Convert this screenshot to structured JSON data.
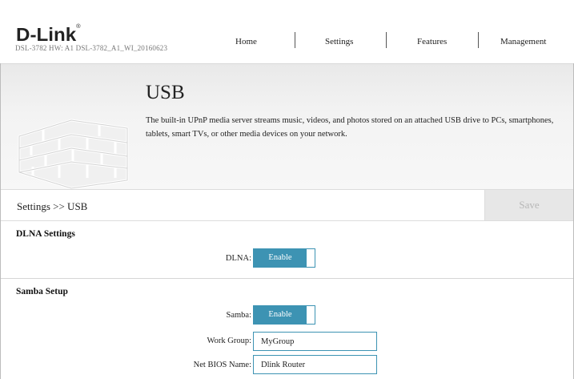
{
  "header": {
    "logo": "D-Link",
    "model_info": "DSL-3782  HW: A1  DSL-3782_A1_WI_20160623",
    "nav": [
      "Home",
      "Settings",
      "Features",
      "Management"
    ]
  },
  "banner": {
    "title": "USB",
    "description": "The built-in UPnP media server streams music, videos, and photos stored on an attached USB drive to PCs, smartphones, tablets, smart TVs, or other media devices on your network."
  },
  "breadcrumb": "Settings >> USB",
  "save_label": "Save",
  "dlna": {
    "section_title": "DLNA Settings",
    "label": "DLNA:",
    "toggle_label": "Enable"
  },
  "samba": {
    "section_title": "Samba Setup",
    "samba_label": "Samba:",
    "toggle_label": "Enable",
    "workgroup_label": "Work Group:",
    "workgroup_value": "MyGroup",
    "netbios_label": "Net BIOS Name:",
    "netbios_value": "Dlink Router"
  },
  "colors": {
    "accent": "#3d93b3",
    "save_disabled_bg": "#e7e7e7",
    "save_disabled_text": "#b7b7b7"
  },
  "icons": [
    "brick-wall-illustration"
  ]
}
